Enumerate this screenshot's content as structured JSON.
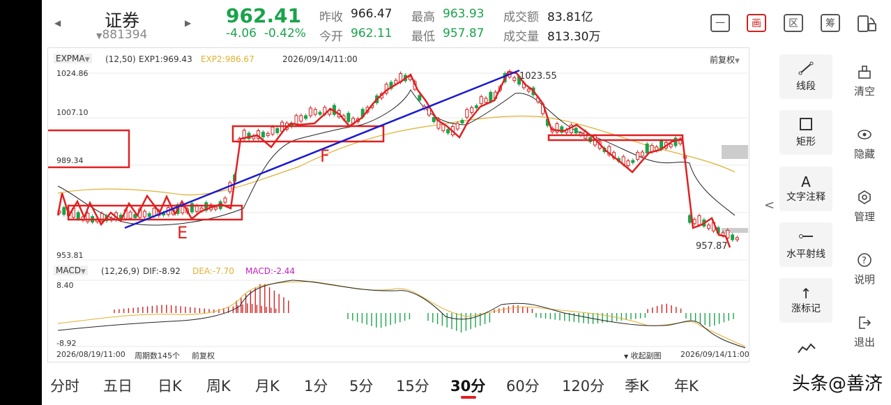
{
  "header": {
    "stock_name": "证券",
    "stock_code": "881394",
    "price": "962.41",
    "change": "-4.06",
    "change_pct": "-0.42%",
    "stats": [
      {
        "label": "昨收",
        "value": "966.47",
        "green": false
      },
      {
        "label": "今开",
        "value": "962.11",
        "green": true
      },
      {
        "label": "最高",
        "value": "963.93",
        "green": true
      },
      {
        "label": "最低",
        "value": "957.87",
        "green": true
      },
      {
        "label": "成交额",
        "value": "83.81亿",
        "green": false
      },
      {
        "label": "成交量",
        "value": "813.30万",
        "green": false
      }
    ],
    "toolbar": [
      "一",
      "画",
      "区",
      "筹"
    ]
  },
  "main_chart": {
    "indicator": "EXPMA",
    "params": "(12,50)",
    "exp1": "EXP1:969.43",
    "exp2": "EXP2:986.67",
    "datetime": "2026/09/14/11:00",
    "adjust": "前复权",
    "y_labels": [
      "1024.86",
      "1007.10",
      "989.34",
      "953.81"
    ],
    "high_label": "1023.55",
    "low_label": "957.87",
    "annotations": [
      "E",
      "F"
    ]
  },
  "macd": {
    "indicator": "MACD",
    "params": "(12,26,9)",
    "dif": "DIF:-8.92",
    "dea": "DEA:-7.70",
    "macd": "MACD:-2.44",
    "y_top": "8.40",
    "y_bottom": "-8.92"
  },
  "footer": {
    "start": "2026/08/19/11:00",
    "period_count": "周期数145个",
    "adjust": "前复权",
    "collapse": "收起副图",
    "end": "2026/09/14/11:00"
  },
  "tools": [
    {
      "label": "线段",
      "icon": "line-segment-icon"
    },
    {
      "label": "矩形",
      "icon": "rectangle-icon"
    },
    {
      "label": "文字注释",
      "icon": "text-annotation-icon"
    },
    {
      "label": "水平射线",
      "icon": "horizontal-ray-icon"
    },
    {
      "label": "涨标记",
      "icon": "up-mark-icon"
    }
  ],
  "side_menu": [
    {
      "label": "清空",
      "icon": "clear-icon"
    },
    {
      "label": "隐藏",
      "icon": "eye-icon"
    },
    {
      "label": "管理",
      "icon": "manage-icon"
    },
    {
      "label": "说明",
      "icon": "help-icon"
    },
    {
      "label": "退出",
      "icon": "exit-icon"
    }
  ],
  "periods": [
    "分时",
    "五日",
    "日K",
    "周K",
    "月K",
    "1分",
    "5分",
    "15分",
    "30分",
    "60分",
    "120分",
    "季K",
    "年K"
  ],
  "active_period": "30分",
  "watermark": "头条@善济",
  "colors": {
    "down": "#1aa34a",
    "up": "#d02020",
    "exp2": "#e0b030",
    "trend": "#1a1ad0"
  }
}
